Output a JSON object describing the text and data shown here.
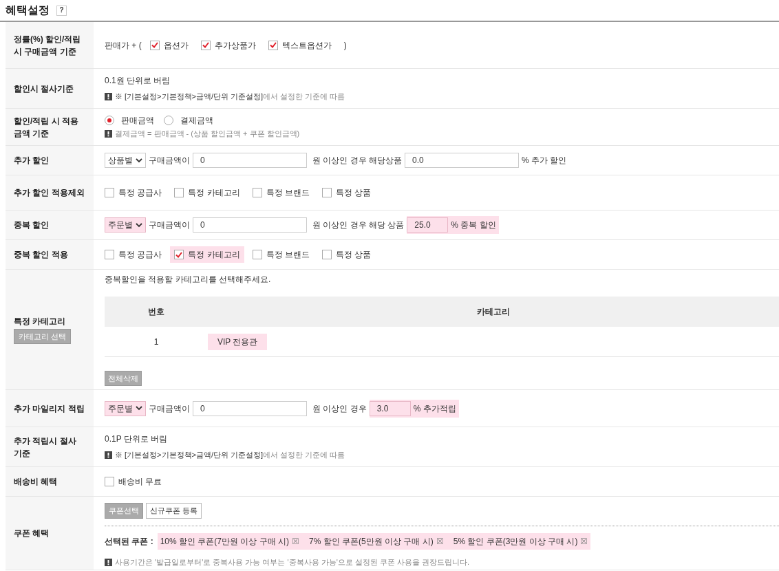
{
  "title": "혜택설정",
  "help_label": "?",
  "rows": [
    {
      "kind": "checks",
      "label": [
        "정률(%) 할인/적립 시",
        "구매금액 기준"
      ],
      "prefix": "판매가 + (",
      "suffix": ")",
      "items": [
        {
          "label": "옵션가",
          "checked": true,
          "highlighted": false
        },
        {
          "label": "추가상품가",
          "checked": true,
          "highlighted": false
        },
        {
          "label": "텍스트옵션가",
          "checked": true,
          "highlighted": false
        }
      ]
    },
    {
      "kind": "text_note",
      "label": [
        "할인시 절사기준"
      ],
      "text": "0.1원 단위로 버림",
      "note_path": "※ [기본설정>기본정책>금액/단위 기준설정]",
      "note": "에서 설정한 기준에 따름"
    },
    {
      "kind": "radios",
      "label": [
        "할인/적립 시 적용",
        "금액 기준"
      ],
      "options": [
        {
          "label": "판매금액",
          "selected": true
        },
        {
          "label": "결제금액",
          "selected": false
        }
      ],
      "note": "결제금액 = 판매금액 - (상품 할인금액 + 쿠폰 할인금액)"
    },
    {
      "kind": "condition",
      "label": [
        "추가 할인"
      ],
      "select": "상품별",
      "select_highlighted": false,
      "amount_label": "구매금액이",
      "amount": "0",
      "middle": "원 이상인 경우 해당상품",
      "rate": "0.0",
      "rate_highlighted": false,
      "suffix": "% 추가 할인"
    },
    {
      "kind": "checks",
      "label": [
        "추가 할인",
        "적용제외"
      ],
      "items": [
        {
          "label": "특정 공급사",
          "checked": false,
          "highlighted": false
        },
        {
          "label": "특정 카테고리",
          "checked": false,
          "highlighted": false
        },
        {
          "label": "특정 브랜드",
          "checked": false,
          "highlighted": false
        },
        {
          "label": "특정 상품",
          "checked": false,
          "highlighted": false
        }
      ]
    },
    {
      "kind": "condition",
      "label": [
        "중복 할인"
      ],
      "select": "주문별",
      "select_highlighted": true,
      "amount_label": "구매금액이",
      "amount": "0",
      "middle": "원 이상인 경우 해당 상품",
      "rate": "25.0",
      "rate_highlighted": true,
      "suffix": "% 중복 할인"
    },
    {
      "kind": "checks",
      "label": [
        "중복 할인 적용"
      ],
      "items": [
        {
          "label": "특정 공급사",
          "checked": false,
          "highlighted": false
        },
        {
          "label": "특정 카테고리",
          "checked": true,
          "highlighted": true
        },
        {
          "label": "특정 브랜드",
          "checked": false,
          "highlighted": false
        },
        {
          "label": "특정 상품",
          "checked": false,
          "highlighted": false
        }
      ]
    },
    {
      "kind": "category",
      "label": [
        "특정 카테고리"
      ],
      "select_button": "카테고리 선택",
      "instruction": "중복할인을 적용할 카테고리를 선택해주세요.",
      "columns": [
        "번호",
        "카테고리"
      ],
      "table_rows": [
        {
          "number": "1",
          "name": "VIP 전용관",
          "highlighted": true
        }
      ],
      "delete_button": "전체삭제"
    },
    {
      "kind": "condition",
      "label": [
        "추가 마일리지 적립"
      ],
      "select": "주문별",
      "select_highlighted": true,
      "amount_label": "구매금액이",
      "amount": "0",
      "middle": "원 이상인 경우",
      "rate": "3.0",
      "rate_highlighted": true,
      "suffix": "% 추가적립"
    },
    {
      "kind": "text_note",
      "label": [
        "추가 적립시 절사",
        "기준"
      ],
      "text": "0.1P 단위로 버림",
      "note_path": "※ [기본설정>기본정책>금액/단위 기준설정]",
      "note": "에서 설정한 기준에 따름"
    },
    {
      "kind": "checks",
      "label": [
        "배송비 혜택"
      ],
      "items": [
        {
          "label": "배송비 무료",
          "checked": false,
          "highlighted": false
        }
      ]
    },
    {
      "kind": "coupon",
      "label": [
        "쿠폰 혜택"
      ],
      "buttons": [
        {
          "label": "쿠폰선택",
          "kind": "filled"
        },
        {
          "label": "신규쿠폰 등록",
          "kind": "outline"
        }
      ],
      "selected_label": "선택된 쿠폰 :",
      "coupons_highlighted": true,
      "coupons": [
        {
          "name": "10% 할인 쿠폰(7만원 이상 구매 시)",
          "remove": "☒"
        },
        {
          "name": "7% 할인 쿠폰(5만원 이상 구매 시)",
          "remove": "☒"
        },
        {
          "name": "5% 할인 쿠폰(3만원 이상 구매 시)",
          "remove": "☒"
        }
      ],
      "note": "사용기간은 '발급일로부터'로 중복사용 가능 여부는 '중복사용 가능'으로 설정된 쿠폰 사용을 권장드립니다."
    }
  ]
}
